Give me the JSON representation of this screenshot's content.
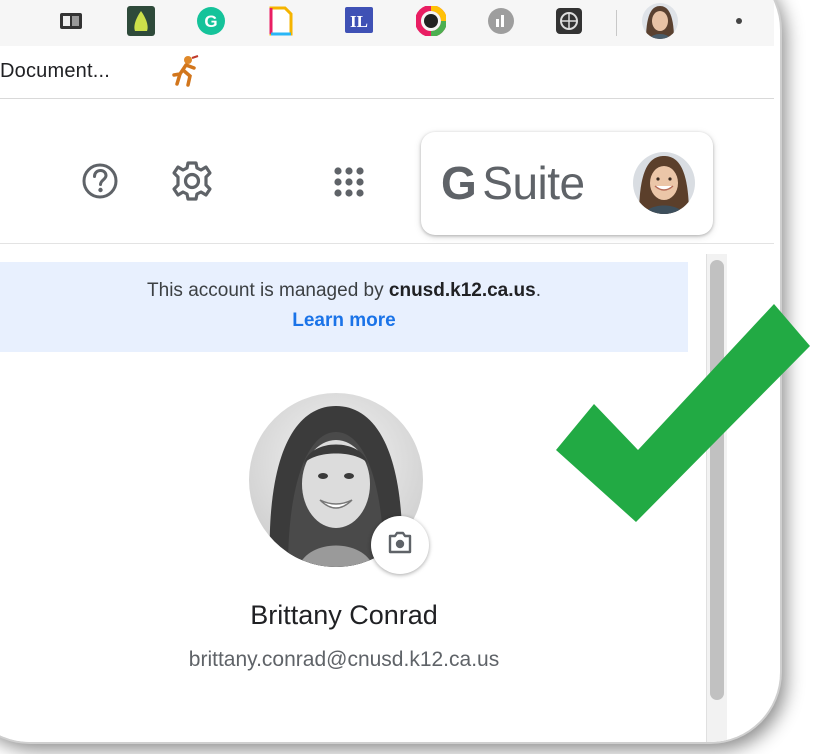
{
  "bookmarks": {
    "items": [
      {
        "label": "Document..."
      }
    ]
  },
  "header": {
    "help_icon": "help-circle-icon",
    "settings_icon": "gear-icon",
    "apps_icon": "apps-grid-icon",
    "brand": {
      "g": "G",
      "suite": "Suite"
    }
  },
  "account": {
    "managed_prefix": "This account is managed by ",
    "managed_domain": "cnusd.k12.ca.us",
    "managed_suffix": ".",
    "learn_more": "Learn more",
    "name": "Brittany Conrad",
    "email": "brittany.conrad@cnusd.k12.ca.us",
    "change_photo_icon": "camera-icon"
  },
  "colors": {
    "link": "#1a73e8",
    "banner": "#e8f0fe",
    "checkmark": "#22aa44"
  }
}
